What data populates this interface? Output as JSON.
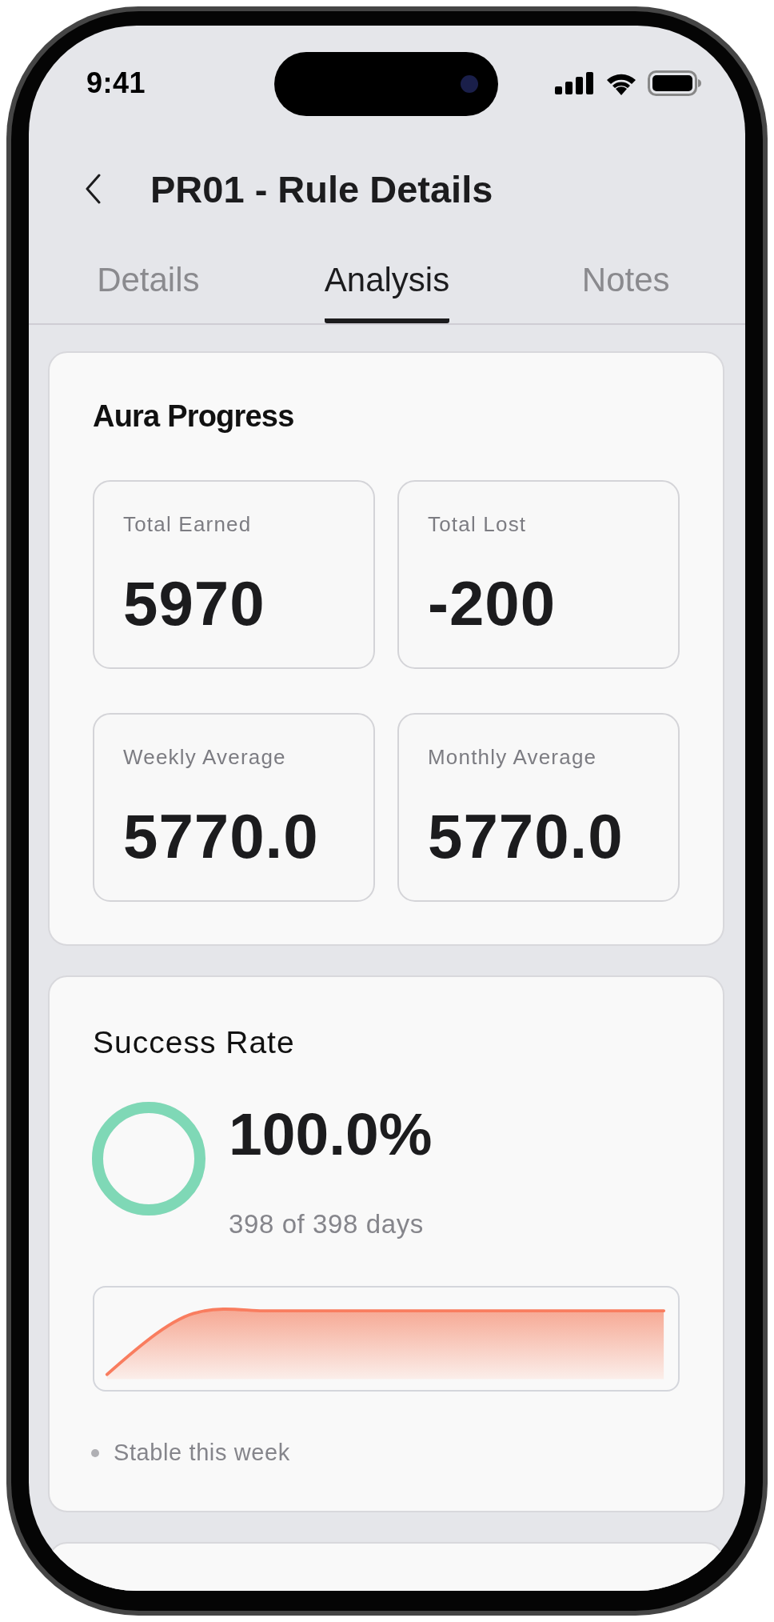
{
  "status_bar": {
    "time": "9:41"
  },
  "header": {
    "title": "PR01 - Rule Details"
  },
  "tabs": [
    {
      "label": "Details",
      "selected": false
    },
    {
      "label": "Analysis",
      "selected": true
    },
    {
      "label": "Notes",
      "selected": false
    }
  ],
  "aura_progress": {
    "title": "Aura Progress",
    "stats": [
      {
        "label": "Total Earned",
        "value": "5970"
      },
      {
        "label": "Total Lost",
        "value": "-200"
      },
      {
        "label": "Weekly Average",
        "value": "5770.0"
      },
      {
        "label": "Monthly Average",
        "value": "5770.0"
      }
    ]
  },
  "success_rate": {
    "title": "Success Rate",
    "level": 1,
    "percent": "100.0%",
    "days": "398 of 398 days",
    "trend_note": "Stable this week"
  }
}
